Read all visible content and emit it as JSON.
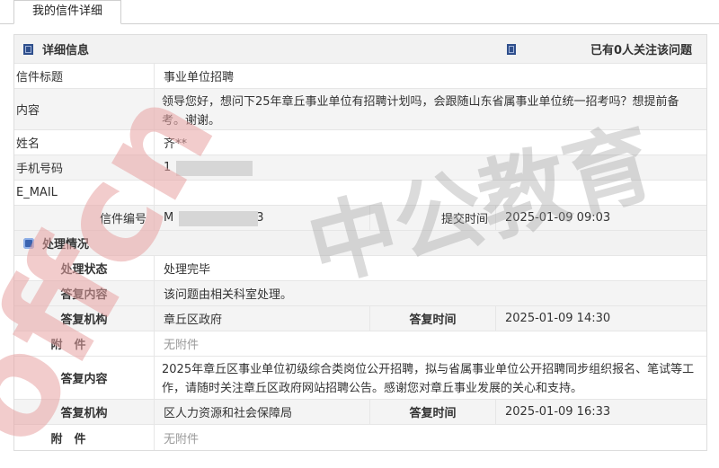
{
  "tabs": {
    "active_label": "我的信件详细"
  },
  "detail": {
    "section_title": "详细信息",
    "follow_text": "已有0人关注该问题",
    "rows": {
      "subject": {
        "label": "信件标题",
        "value": "事业单位招聘"
      },
      "content": {
        "label": "内容",
        "value": "领导您好，想问下25年章丘事业单位有招聘计划吗，会跟随山东省属事业单位统一招考吗？想提前备考。谢谢。"
      },
      "name": {
        "label": "姓名",
        "value": "齐**"
      },
      "phone": {
        "label": "手机号码",
        "value": "1"
      },
      "email": {
        "label": "E_MAIL",
        "value": ""
      },
      "letter": {
        "label": "信件编号",
        "value": "M",
        "value_tail": "3",
        "submit_label": "提交时间",
        "submit_time": "2025-01-09 09:03"
      }
    }
  },
  "process": {
    "section_title": "处理情况",
    "status_label": "处理状态",
    "status_value": "处理完毕",
    "reply_label": "答复内容",
    "reply_value": "该问题由相关科室处理。",
    "replies": [
      {
        "org_label": "答复机构",
        "org": "章丘区政府",
        "time_label": "答复时间",
        "time": "2025-01-09 14:30",
        "attach_label": "附　件",
        "attach": "无附件"
      },
      {
        "content_label": "答复内容",
        "content": "2025年章丘区事业单位初级综合类岗位公开招聘，拟与省属事业单位公开招聘同步组织报名、笔试等工作，请随时关注章丘区政府网站招聘公告。感谢您对章丘事业发展的关心和支持。",
        "org_label": "答复机构",
        "org": "区人力资源和社会保障局",
        "time_label": "答复时间",
        "time": "2025-01-09 16:33",
        "attach_label": "附　件",
        "attach": "无附件"
      }
    ]
  },
  "watermark": {
    "logo_text": "offcn",
    "brand_text": "中公教育"
  }
}
